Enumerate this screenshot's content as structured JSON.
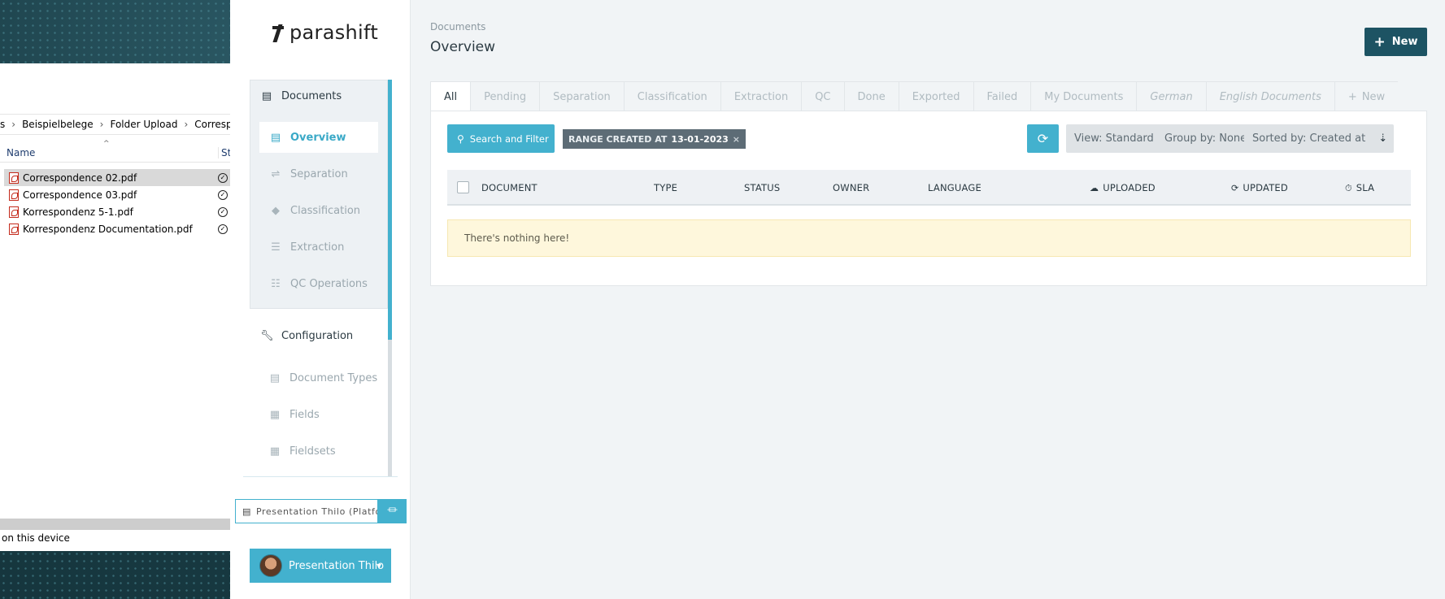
{
  "explorer": {
    "breadcrumbs": [
      "s",
      "Beispielbelege",
      "Folder Upload",
      "Correspondence"
    ],
    "columns": {
      "name": "Name",
      "status": "Sta"
    },
    "files": [
      {
        "name": "Correspondence 02.pdf",
        "selected": true
      },
      {
        "name": "Correspondence 03.pdf",
        "selected": false
      },
      {
        "name": "Korrespondenz 5-1.pdf",
        "selected": false
      },
      {
        "name": "Korrespondenz Documentation.pdf",
        "selected": false
      }
    ],
    "status_text": "on this device"
  },
  "app": {
    "logo_text": "parashift",
    "sidebar": {
      "documents": {
        "label": "Documents",
        "icon": "document-icon",
        "items": [
          {
            "label": "Overview",
            "icon": "document-icon",
            "active": true
          },
          {
            "label": "Separation",
            "icon": "separation-icon",
            "active": false
          },
          {
            "label": "Classification",
            "icon": "tags-icon",
            "active": false
          },
          {
            "label": "Extraction",
            "icon": "list-icon",
            "active": false
          },
          {
            "label": "QC Operations",
            "icon": "checklist-icon",
            "active": false
          }
        ]
      },
      "configuration": {
        "label": "Configuration",
        "icon": "wrench-icon",
        "items": [
          {
            "label": "Document Types",
            "icon": "document-icon"
          },
          {
            "label": "Fields",
            "icon": "table-icon"
          },
          {
            "label": "Fieldsets",
            "icon": "table-icon"
          }
        ]
      },
      "tenant_input": {
        "value": "Presentation Thilo (Platform)"
      },
      "user_button": {
        "label": "Presentation Thilo"
      }
    },
    "header": {
      "breadcrumb": "Documents",
      "title": "Overview",
      "new_button": "New"
    },
    "tabs": [
      {
        "label": "All",
        "active": true,
        "italic": false
      },
      {
        "label": "Pending",
        "active": false,
        "italic": false
      },
      {
        "label": "Separation",
        "active": false,
        "italic": false
      },
      {
        "label": "Classification",
        "active": false,
        "italic": false
      },
      {
        "label": "Extraction",
        "active": false,
        "italic": false
      },
      {
        "label": "QC",
        "active": false,
        "italic": false
      },
      {
        "label": "Done",
        "active": false,
        "italic": false
      },
      {
        "label": "Exported",
        "active": false,
        "italic": false
      },
      {
        "label": "Failed",
        "active": false,
        "italic": false
      },
      {
        "label": "My Documents",
        "active": false,
        "italic": false
      },
      {
        "label": "German",
        "active": false,
        "italic": true
      },
      {
        "label": "English Documents",
        "active": false,
        "italic": true
      }
    ],
    "add_tab_label": "New",
    "toolbar": {
      "search_label": "Search and Filter",
      "filter_chip": {
        "key": "RANGE CREATED AT",
        "value": "13-01-2023",
        "remove": "×"
      },
      "view_label": "View: Standard",
      "group_label": "Group by: None",
      "sort_label": "Sorted by: Created at"
    },
    "table": {
      "columns": [
        "DOCUMENT",
        "TYPE",
        "STATUS",
        "OWNER",
        "LANGUAGE",
        "UPLOADED",
        "UPDATED",
        "SLA"
      ],
      "empty_message": "There's nothing here!"
    },
    "colors": {
      "accent": "#43b1ce",
      "primary_dark": "#1d5363",
      "chip_bg": "#5d6c76",
      "empty_bg": "#fef7dc"
    }
  }
}
